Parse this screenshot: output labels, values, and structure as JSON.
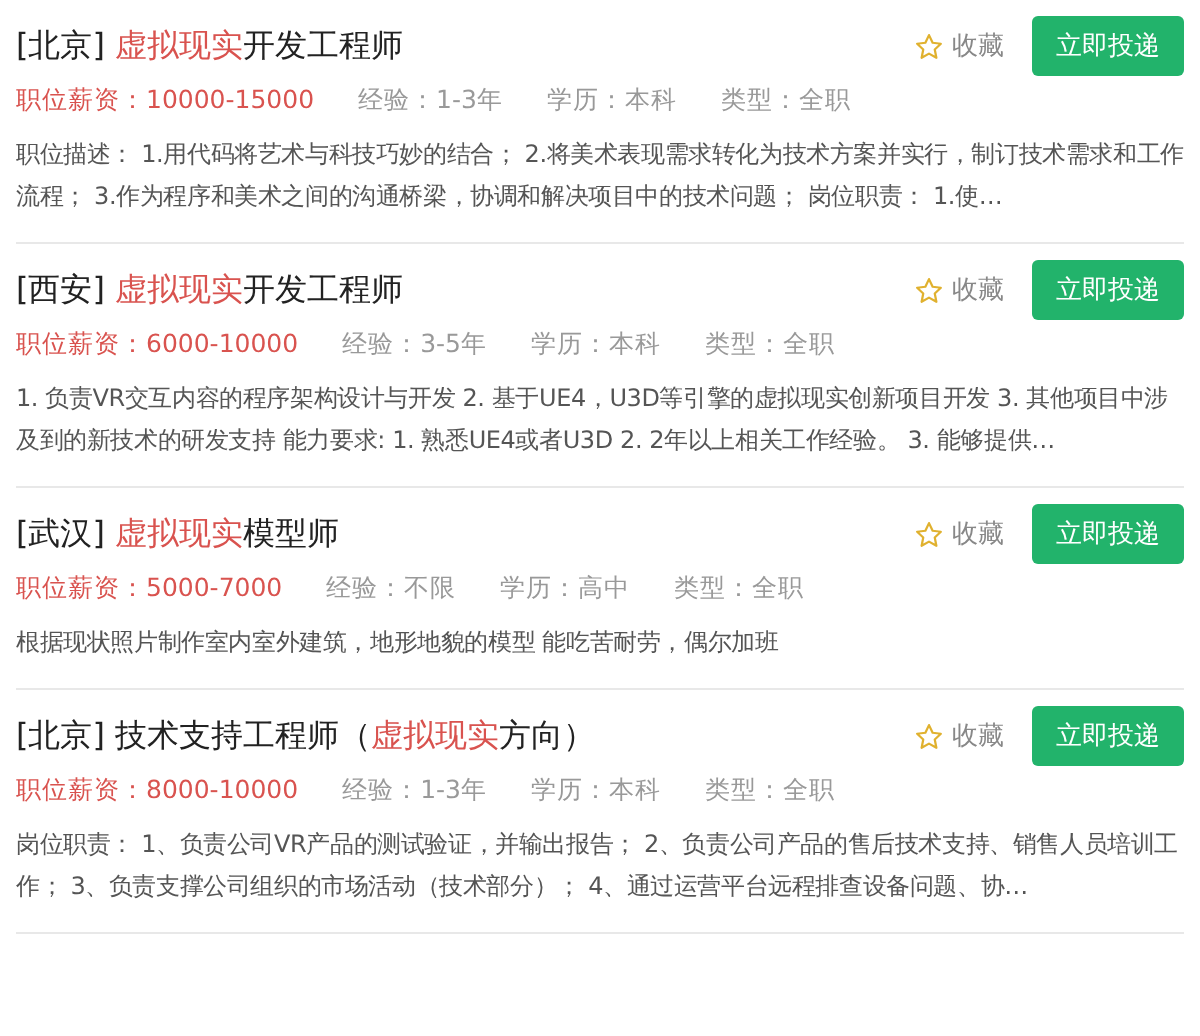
{
  "jobs": [
    {
      "title": "[北京] **虚拟现实**开发工程师",
      "salary": "职位薪资：10000-15000",
      "experience": "经验：1-3年",
      "education": "学历：本科",
      "type": "类型：全职",
      "favorite": "收藏",
      "apply": "立即投递",
      "description": "职位描述： 1.用代码将艺术与科技巧妙的结合； 2.将美术表现需求转化为技术方案并实行，制订技术需求和工作流程； 3.作为程序和美术之间的沟通桥梁，协调和解决项目中的技术问题； 岗位职责： 1.使…"
    },
    {
      "title": "[西安] **虚拟现实**开发工程师",
      "salary": "职位薪资：6000-10000",
      "experience": "经验：3-5年",
      "education": "学历：本科",
      "type": "类型：全职",
      "favorite": "收藏",
      "apply": "立即投递",
      "description": "1. 负责VR交互内容的程序架构设计与开发 2. 基于UE4，U3D等引擎的虚拟现实创新项目开发 3. 其他项目中涉及到的新技术的研发支持 能力要求: 1. 熟悉UE4或者U3D 2. 2年以上相关工作经验。 3. 能够提供…"
    },
    {
      "title": "[武汉] **虚拟现实**模型师",
      "salary": "职位薪资：5000-7000",
      "experience": "经验：不限",
      "education": "学历：高中",
      "type": "类型：全职",
      "favorite": "收藏",
      "apply": "立即投递",
      "description": "根据现状照片制作室内室外建筑，地形地貌的模型 能吃苦耐劳，偶尔加班"
    },
    {
      "title": "[北京] 技术支持工程师（**虚拟现实**方向）",
      "salary": "职位薪资：8000-10000",
      "experience": "经验：1-3年",
      "education": "学历：本科",
      "type": "类型：全职",
      "favorite": "收藏",
      "apply": "立即投递",
      "description": "岗位职责： 1、负责公司VR产品的测试验证，并输出报告； 2、负责公司产品的售后技术支持、销售人员培训工作； 3、负责支撑公司组织的市场活动（技术部分）； 4、通过运营平台远程排查设备问题、协…"
    }
  ]
}
